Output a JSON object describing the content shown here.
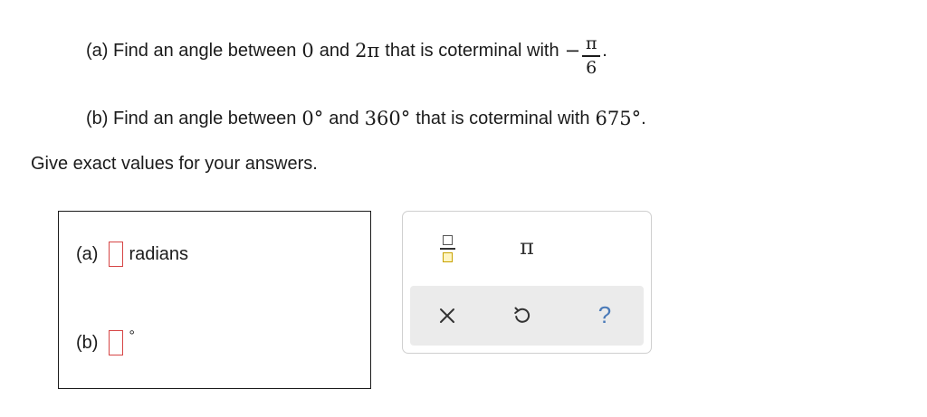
{
  "question_a": {
    "prefix": "(a) Find an angle between",
    "lower": "0",
    "and_word": "and",
    "upper": "2π",
    "mid": "that is coterminal with",
    "sign": "−",
    "numerator": "π",
    "denominator": "6",
    "end": "."
  },
  "question_b": {
    "prefix": "(b) Find an angle between",
    "lower": "0°",
    "and_word": "and",
    "upper": "360°",
    "mid": "that is coterminal with",
    "target": "675°",
    "end": "."
  },
  "instructions": "Give exact values for your answers.",
  "answers": {
    "a_label": "(a)",
    "a_unit": "radians",
    "b_label": "(b)",
    "b_unit": "°",
    "a_value": "",
    "b_value": ""
  },
  "palette": {
    "pi_symbol": "π",
    "help_symbol": "?"
  },
  "icons": {
    "fraction": "fraction-icon",
    "pi": "pi-icon",
    "clear": "x-icon",
    "undo": "undo-icon",
    "help": "help-icon"
  },
  "colors": {
    "input_border": "#d64545",
    "fraction_accent": "#c8a200",
    "action_bar_bg": "#ebebeb",
    "help_color": "#4a7ab8"
  }
}
